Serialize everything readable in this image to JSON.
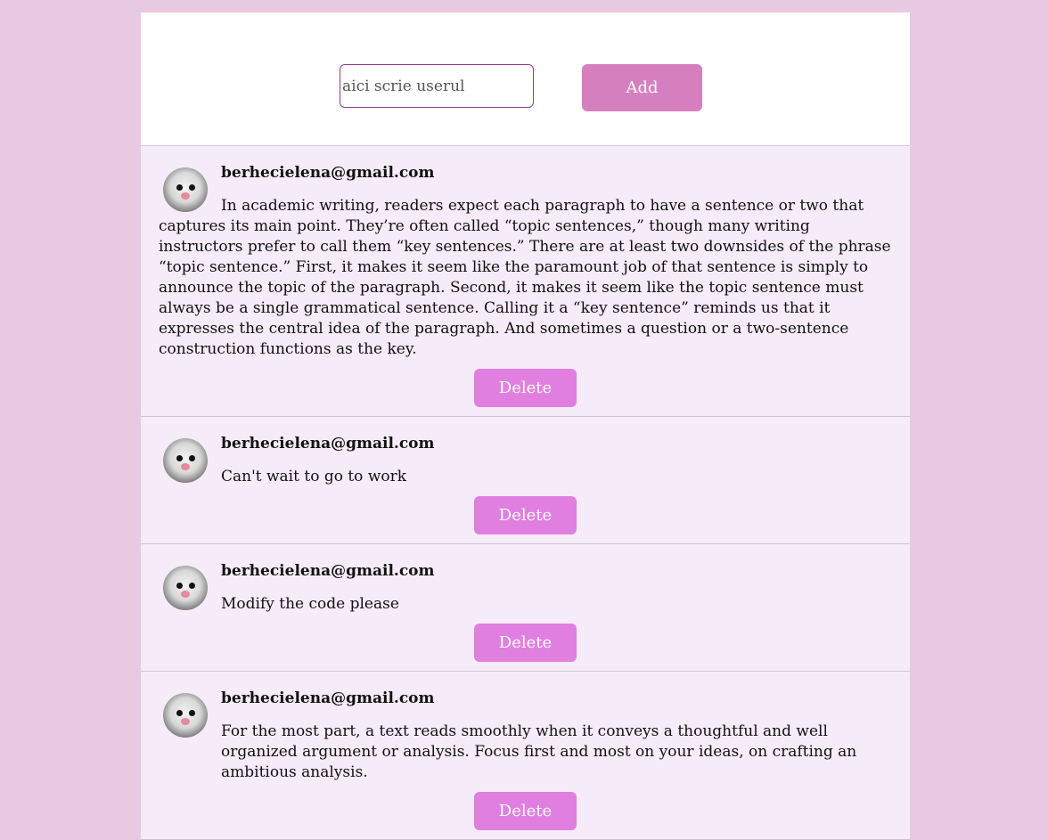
{
  "composer": {
    "placeholder": "aici scrie userul",
    "add_label": "Add"
  },
  "posts": [
    {
      "user": "berhecielena@gmail.com",
      "text": "In academic writing, readers expect each paragraph to have a sentence or two that captures its main point. They’re often called “topic sentences,” though many writing instructors prefer to call them “key sentences.” There are at least two downsides of the phrase “topic sentence.” First, it makes it seem like the paramount job of that sentence is simply to announce the topic of the paragraph. Second, it makes it seem like the topic sentence must always be a single grammatical sentence. Calling it a “key sentence” reminds us that it expresses the central idea of the paragraph. And sometimes a question or a two-sentence construction functions as the key.",
      "delete_label": "Delete"
    },
    {
      "user": "berhecielena@gmail.com",
      "text": "Can't wait to go to work",
      "delete_label": "Delete"
    },
    {
      "user": "berhecielena@gmail.com",
      "text": "Modify the code please",
      "delete_label": "Delete"
    },
    {
      "user": "berhecielena@gmail.com",
      "text": "For the most part, a text reads smoothly when it conveys a thoughtful and well organized argument or analysis. Focus first and most on your ideas, on crafting an ambitious analysis.",
      "delete_label": "Delete"
    }
  ]
}
